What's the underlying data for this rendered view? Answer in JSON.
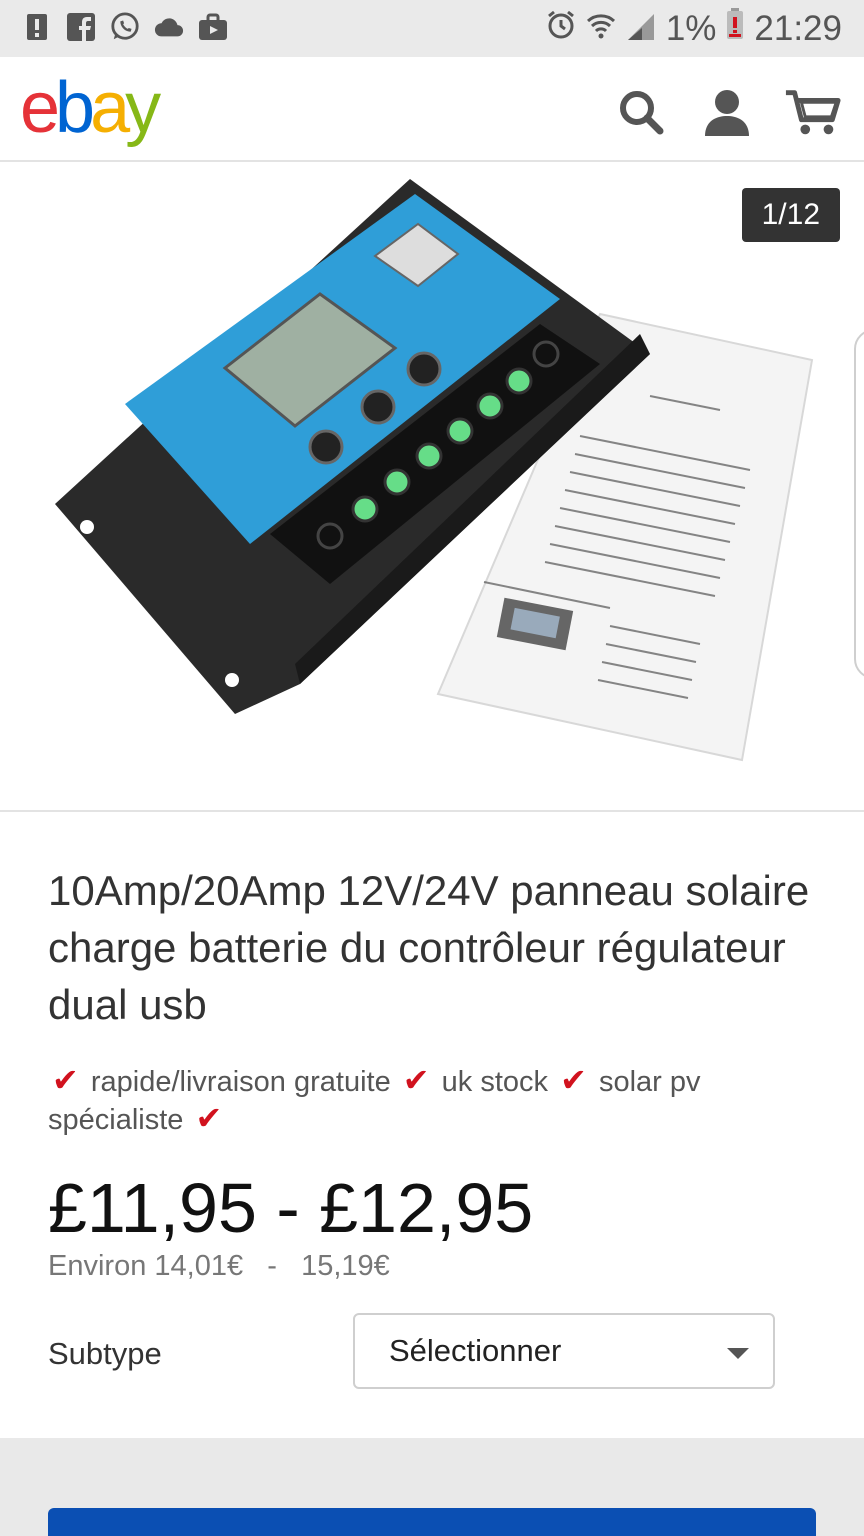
{
  "status_bar": {
    "left_icons": [
      "alert-icon",
      "facebook-icon",
      "whatsapp-icon",
      "cloud-icon",
      "briefcase-icon"
    ],
    "right_icons": [
      "alarm-icon",
      "wifi-icon",
      "signal-icon",
      "battery-icon"
    ],
    "battery": "1%",
    "time": "21:29"
  },
  "header": {
    "logo": {
      "e": "e",
      "b": "b",
      "a": "a",
      "y": "y"
    },
    "icons": [
      "search-icon",
      "user-icon",
      "cart-icon"
    ]
  },
  "gallery": {
    "counter": "1/12"
  },
  "listing": {
    "title": "10Amp/20Amp 12V/24V panneau solaire charge batterie du contrôleur régulateur dual usb",
    "features": {
      "f1": "rapide/livraison gratuite",
      "f2": "uk stock",
      "f3": "solar pv",
      "f4": "spécialiste",
      "check": "✔"
    },
    "price": "£11,95 - £12,95",
    "converted": "Environ 14,01€   -   15,19€",
    "subtype_label": "Subtype",
    "subtype_select": "Sélectionner"
  },
  "colors": {
    "ebay_red": "#e53238",
    "ebay_blue": "#0064d2",
    "ebay_yellow": "#f5af02",
    "ebay_green": "#86b817",
    "check_red": "#d1121e",
    "buy_blue": "#0b4fb3"
  }
}
